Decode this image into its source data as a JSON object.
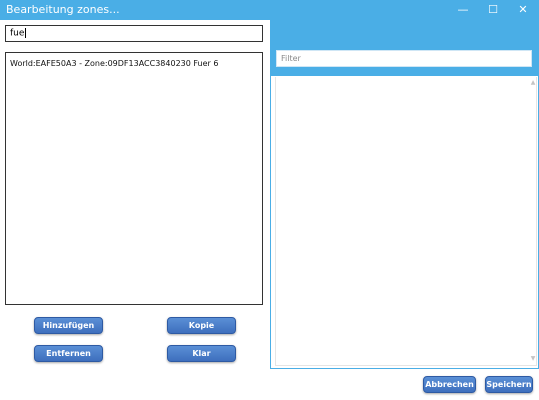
{
  "window": {
    "title": "Bearbeitung zones...",
    "controls": {
      "minimize": "—",
      "maximize": "☐",
      "close": "✕"
    }
  },
  "left": {
    "search_value": "fue",
    "list_items": [
      "World:EAFE50A3 - Zone:09DF13ACC3840230 Fuer 6"
    ],
    "buttons": {
      "add": "Hinzufügen",
      "copy": "Kopie",
      "remove": "Entfernen",
      "clear": "Klar"
    }
  },
  "right": {
    "filter_placeholder": "Filter",
    "scroll_up": "▲",
    "scroll_down": "▼"
  },
  "footer": {
    "cancel": "Abbrechen",
    "save": "Speichern"
  },
  "colors": {
    "accent": "#4aaee6",
    "button": "#3e6fbd"
  }
}
